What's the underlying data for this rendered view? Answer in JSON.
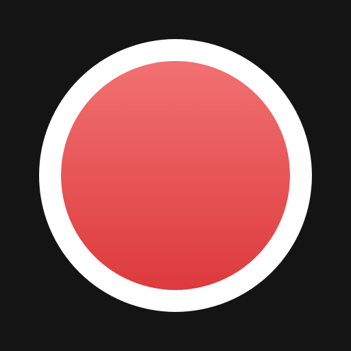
{
  "icon": {
    "name": "record-icon",
    "colors": {
      "background": "#141414",
      "ring": "#ffffff",
      "dot_top": "#f17172",
      "dot_bottom": "#dd3a3c"
    }
  }
}
